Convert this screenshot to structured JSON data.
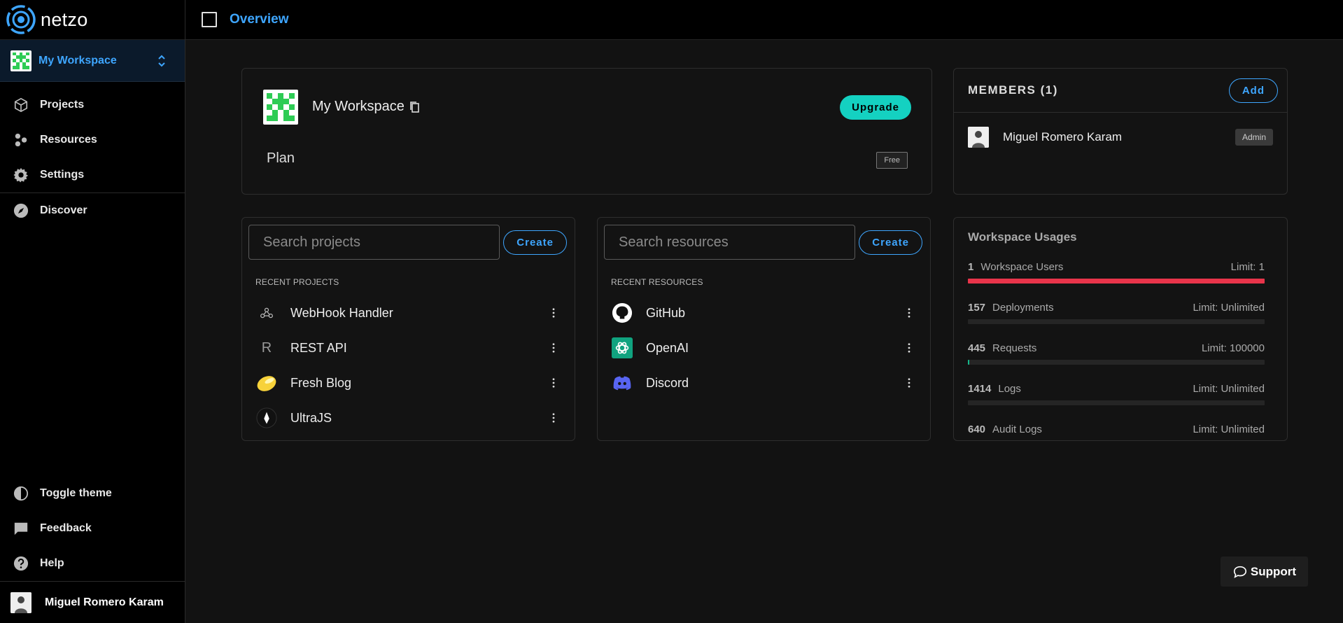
{
  "app": {
    "name": "netzo"
  },
  "sidebar": {
    "workspace": "My Workspace",
    "items": [
      {
        "label": "Projects",
        "icon": "cube-icon"
      },
      {
        "label": "Resources",
        "icon": "resources-icon"
      },
      {
        "label": "Settings",
        "icon": "gear-icon"
      },
      {
        "label": "Discover",
        "icon": "compass-icon"
      }
    ],
    "bottom_items": [
      {
        "label": "Toggle theme",
        "icon": "contrast-icon"
      },
      {
        "label": "Feedback",
        "icon": "feedback-icon"
      },
      {
        "label": "Help",
        "icon": "help-icon"
      }
    ],
    "user": "Miguel Romero Karam"
  },
  "header": {
    "title": "Overview"
  },
  "workspace_card": {
    "name": "My Workspace",
    "upgrade_label": "Upgrade",
    "plan_label": "Plan",
    "plan_value": "Free"
  },
  "members": {
    "title": "MEMBERS (1)",
    "add_label": "Add",
    "list": [
      {
        "name": "Miguel Romero Karam",
        "role": "Admin"
      }
    ]
  },
  "projects": {
    "search_placeholder": "Search projects",
    "create_label": "Create",
    "section_label": "RECENT PROJECTS",
    "items": [
      {
        "label": "WebHook Handler",
        "icon": "webhook-icon"
      },
      {
        "label": "REST API",
        "icon": "letter-r-icon",
        "glyph": "R"
      },
      {
        "label": "Fresh Blog",
        "icon": "fresh-lemon-icon"
      },
      {
        "label": "UltraJS",
        "icon": "ultrajs-icon"
      }
    ]
  },
  "resources": {
    "search_placeholder": "Search resources",
    "create_label": "Create",
    "section_label": "RECENT RESOURCES",
    "items": [
      {
        "label": "GitHub",
        "icon": "github-icon"
      },
      {
        "label": "OpenAI",
        "icon": "openai-icon"
      },
      {
        "label": "Discord",
        "icon": "discord-icon"
      }
    ]
  },
  "usage": {
    "title": "Workspace Usages",
    "rows": [
      {
        "count": "1",
        "name": "Workspace Users",
        "limit": "Limit: 1",
        "fill": 1.0,
        "color": "#e8344a"
      },
      {
        "count": "157",
        "name": "Deployments",
        "limit": "Limit: Unlimited",
        "fill": 0,
        "color": "#14b88a"
      },
      {
        "count": "445",
        "name": "Requests",
        "limit": "Limit: 100000",
        "fill": 0.00445,
        "color": "#14b88a"
      },
      {
        "count": "1414",
        "name": "Logs",
        "limit": "Limit: Unlimited",
        "fill": 0,
        "color": "#14b88a"
      },
      {
        "count": "640",
        "name": "Audit Logs",
        "limit": "Limit: Unlimited",
        "fill": 0,
        "color": "#14b88a"
      }
    ]
  },
  "support": {
    "label": "Support"
  },
  "colors": {
    "accent": "#3ea6ff",
    "upgrade": "#14d1c1",
    "danger": "#e8344a"
  }
}
